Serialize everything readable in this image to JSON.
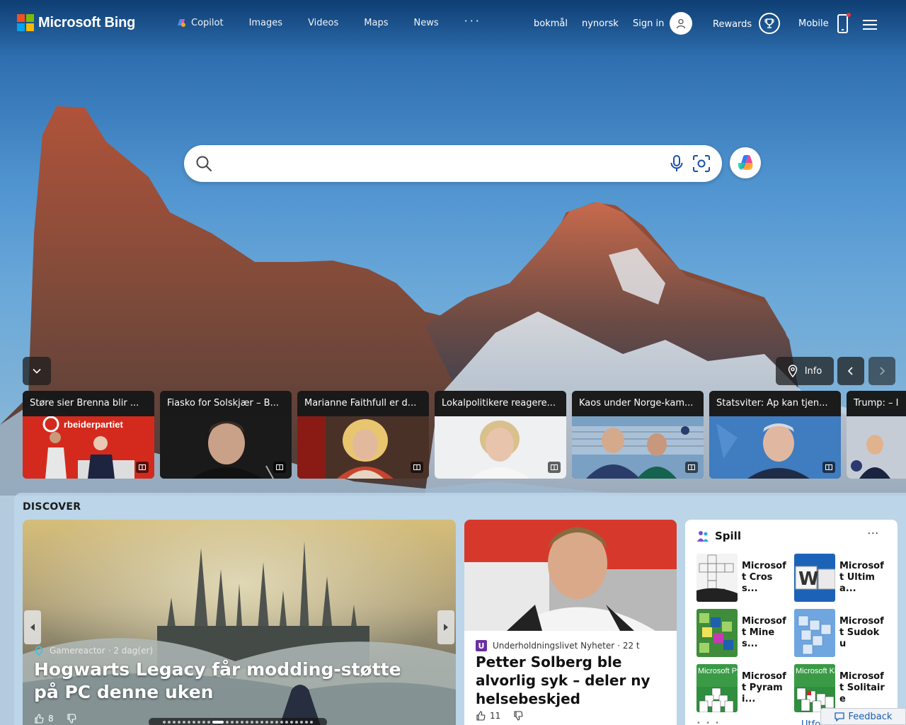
{
  "header": {
    "brand": "Microsoft Bing",
    "brand_colors": [
      "#f25022",
      "#7fba00",
      "#00a4ef",
      "#ffb900"
    ],
    "nav": [
      {
        "label": "Copilot",
        "icon": "copilot-icon"
      },
      {
        "label": "Images"
      },
      {
        "label": "Videos"
      },
      {
        "label": "Maps"
      },
      {
        "label": "News"
      }
    ],
    "more_label": "···",
    "lang1": "bokmål",
    "lang2": "nynorsk",
    "sign_in": "Sign in",
    "rewards": "Rewards",
    "mobile": "Mobile"
  },
  "search": {
    "value": "",
    "placeholder": ""
  },
  "carousel": {
    "info_label": "Info"
  },
  "news_strip": [
    {
      "title": "Støre sier Brenna blir ..."
    },
    {
      "title": "Fiasko for Solskjær – B..."
    },
    {
      "title": "Marianne Faithfull er d..."
    },
    {
      "title": "Lokalpolitikere reagere..."
    },
    {
      "title": "Kaos under Norge-kam..."
    },
    {
      "title": "Statsviter: Ap kan tjen..."
    },
    {
      "title": "Trump: – I"
    }
  ],
  "tile_image_text": "rbeiderpartiet",
  "discover": {
    "title": "DISCOVER",
    "hero": {
      "source": "Gamereactor",
      "time": "· 2 dag(er)",
      "title": "Hogwarts Legacy får modding-støtte på PC denne uken",
      "likes": "8"
    },
    "card2": {
      "source_badge": "U",
      "source": "Underholdningslivet Nyheter",
      "time": "· 22 t",
      "title": "Petter Solberg ble alvorlig syk – deler ny helsebeskjed",
      "likes": "11"
    },
    "games": {
      "title": "Spill",
      "more": "···",
      "items": [
        {
          "name": "Microsoft Cross..."
        },
        {
          "name": "Microsoft Ultima..."
        },
        {
          "name": "Microsoft Mines..."
        },
        {
          "name": "Microsoft Sudoku"
        },
        {
          "name": "Microsoft Pyrami..."
        },
        {
          "name": "Microsoft Solitaire"
        }
      ],
      "thumb_labels": {
        "pyramid": "Microsoft Pyramid",
        "klondike": "Microsoft Klondike",
        "wordament": "W"
      },
      "pager": "• • •",
      "link": "Utfo"
    }
  },
  "feedback": "Feedback"
}
